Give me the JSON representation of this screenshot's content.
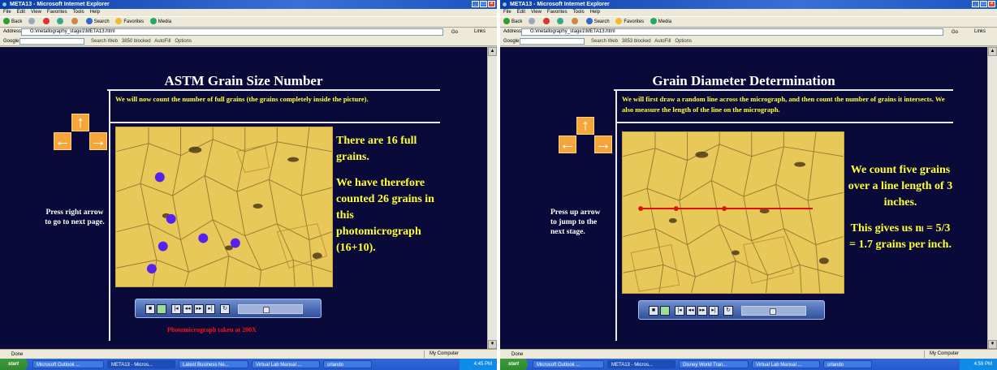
{
  "left": {
    "window_title": "META13 - Microsoft Internet Explorer",
    "address": "G:\\metallography_stage1\\META13.html",
    "blocked": "3850 blocked",
    "page_title": "ASTM Grain Size Number",
    "intro": "We will now count the number of full grains (the grains completely inside the picture).",
    "side_text_1": "There are 16 full grains.",
    "side_text_2": "We have therefore counted 26 grains in this photomicrograph (16+10).",
    "hint": "Press right arrow to go to next page.",
    "caption": "Photomicrograph taken at 200X",
    "status": "Done",
    "zone": "My Computer",
    "clock": "4:45 PM",
    "tasks": [
      "Microsoft Outlook ...",
      "META13 - Micros...",
      "Latest Business Ne...",
      "Virtual Lab Manual ...",
      "orlando"
    ]
  },
  "right": {
    "window_title": "META13 - Microsoft Internet Explorer",
    "address": "G:\\metallography_stage1\\META13.html",
    "blocked": "3853 blocked",
    "page_title": "Grain Diameter Determination",
    "intro": "We will first draw a random line across the micrograph, and then count the number of grains it intersects. We also measure the length of the line on the micrograph.",
    "side_text_1": "We count five grains over a line length of 3 inches.",
    "side_text_2": "This gives us nₗ = 5/3 = 1.7 grains per inch.",
    "hint": "Press up arrow to jump to the next stage.",
    "status": "Done",
    "zone": "My Computer",
    "clock": "4:59 PM",
    "tasks": [
      "Microsoft Outlook ...",
      "META13 - Micros...",
      "Disney World Tran...",
      "Virtual Lab Manual ...",
      "orlando"
    ]
  },
  "common": {
    "menu": [
      "File",
      "Edit",
      "View",
      "Favorites",
      "Tools",
      "Help"
    ],
    "back": "Back",
    "search": "Search",
    "favorites": "Favorites",
    "media": "Media",
    "address_label": "Address",
    "go": "Go",
    "links": "Links",
    "google": "Google",
    "search_web": "Search Web",
    "autofill": "AutoFill",
    "options": "Options",
    "start": "start",
    "colors": {
      "bg": "#0a0a3a",
      "yellow": "#ffff33",
      "nav_orange": "#f4a63a",
      "grain_dot": "#5522ee",
      "line_red": "#dd1111"
    }
  }
}
